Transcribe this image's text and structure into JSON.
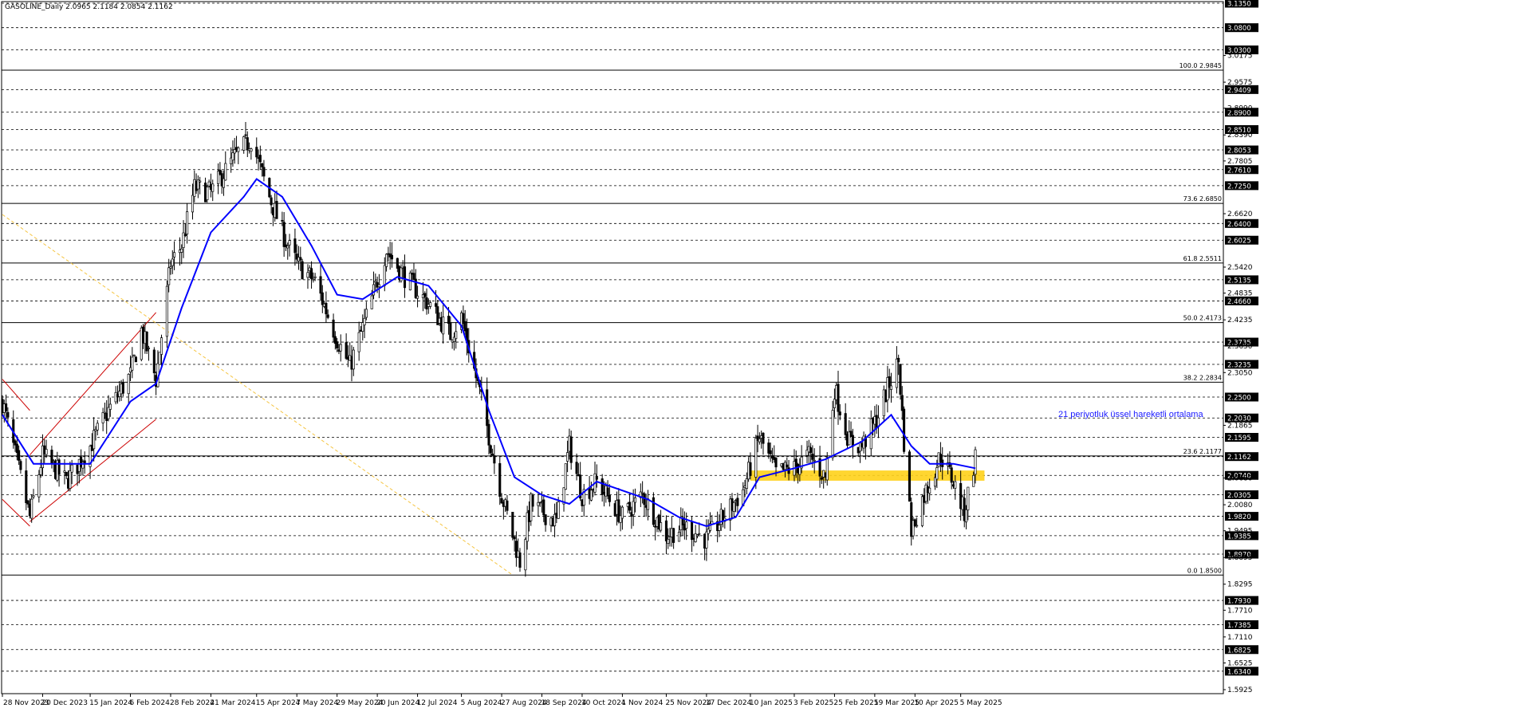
{
  "header": {
    "title": "GASOLINE_Daily  2.0965 2.1184 2.0854 2.1162"
  },
  "colors": {
    "background": "#ffffff",
    "candle": "#000000",
    "ema": "#0000ff",
    "channel": "#cc0000",
    "trendline": "#f5c542",
    "zone": "#ffd21a",
    "grid": "#000000"
  },
  "chart_data": {
    "type": "candlestick",
    "symbol": "GASOLINE",
    "timeframe": "Daily",
    "ohlc_last": {
      "open": 2.0965,
      "high": 2.1184,
      "low": 2.0854,
      "close": 2.1162
    },
    "ylim": [
      1.5925,
      3.135
    ],
    "x_range": [
      "2023-11-28",
      "2025-05-13"
    ],
    "price_levels": [
      {
        "value": 3.135,
        "label": "3.1350"
      },
      {
        "value": 3.08,
        "label": "3.0800"
      },
      {
        "value": 3.03,
        "label": "3.0300"
      },
      {
        "value": 2.9409,
        "label": "2.9409"
      },
      {
        "value": 2.89,
        "label": "2.8900"
      },
      {
        "value": 2.851,
        "label": "2.8510"
      },
      {
        "value": 2.8053,
        "label": "2.8053"
      },
      {
        "value": 2.761,
        "label": "2.7610"
      },
      {
        "value": 2.725,
        "label": "2.7250"
      },
      {
        "value": 2.64,
        "label": "2.6400"
      },
      {
        "value": 2.6025,
        "label": "2.6025"
      },
      {
        "value": 2.5135,
        "label": "2.5135"
      },
      {
        "value": 2.466,
        "label": "2.4660"
      },
      {
        "value": 2.3735,
        "label": "2.3735"
      },
      {
        "value": 2.3235,
        "label": "2.3235"
      },
      {
        "value": 2.25,
        "label": "2.2500"
      },
      {
        "value": 2.203,
        "label": "2.2030"
      },
      {
        "value": 2.1595,
        "label": "2.1595"
      },
      {
        "value": 2.1162,
        "label": "2.1162"
      },
      {
        "value": 2.074,
        "label": "2.0740"
      },
      {
        "value": 2.0305,
        "label": "2.0305"
      },
      {
        "value": 1.982,
        "label": "1.9820"
      },
      {
        "value": 1.9385,
        "label": "1.9385"
      },
      {
        "value": 1.897,
        "label": "1.8970"
      },
      {
        "value": 1.793,
        "label": "1.7930"
      },
      {
        "value": 1.7385,
        "label": "1.7385"
      },
      {
        "value": 1.6825,
        "label": "1.6825"
      },
      {
        "value": 1.634,
        "label": "1.6340"
      }
    ],
    "minor_ticks": [
      {
        "value": 3.0175,
        "label": "3.0175"
      },
      {
        "value": 2.9575,
        "label": "2.9575"
      },
      {
        "value": 2.899,
        "label": "2.8990"
      },
      {
        "value": 2.839,
        "label": "2.8390"
      },
      {
        "value": 2.7805,
        "label": "2.7805"
      },
      {
        "value": 2.662,
        "label": "2.6620"
      },
      {
        "value": 2.542,
        "label": "2.5420"
      },
      {
        "value": 2.4835,
        "label": "2.4835"
      },
      {
        "value": 2.4235,
        "label": "2.4235"
      },
      {
        "value": 2.365,
        "label": "2.3650"
      },
      {
        "value": 2.305,
        "label": "2.3050"
      },
      {
        "value": 2.1865,
        "label": "2.1865"
      },
      {
        "value": 2.068,
        "label": "2.0680"
      },
      {
        "value": 2.008,
        "label": "2.0080"
      },
      {
        "value": 1.9495,
        "label": "1.9495"
      },
      {
        "value": 1.8895,
        "label": "1.8895"
      },
      {
        "value": 1.8295,
        "label": "1.8295"
      },
      {
        "value": 1.771,
        "label": "1.7710"
      },
      {
        "value": 1.711,
        "label": "1.7110"
      },
      {
        "value": 1.6525,
        "label": "1.6525"
      },
      {
        "value": 1.5925,
        "label": "1.5925"
      }
    ],
    "fibonacci": [
      {
        "label": "100.0 2.9845",
        "value": 2.9845
      },
      {
        "label": "73.6 2.6850",
        "value": 2.685
      },
      {
        "label": "61.8 2.5511",
        "value": 2.5511
      },
      {
        "label": "50.0 2.4173",
        "value": 2.4173
      },
      {
        "label": "38.2 2.2834",
        "value": 2.2834
      },
      {
        "label": "23.6 2.1177",
        "value": 2.1177
      },
      {
        "label": "0.0 1.8500",
        "value": 1.85
      }
    ],
    "x_labels": [
      "28 Nov 2023",
      "20 Dec 2023",
      "15 Jan 2024",
      "6 Feb 2024",
      "28 Feb 2024",
      "21 Mar 2024",
      "15 Apr 2024",
      "7 May 2024",
      "29 May 2024",
      "20 Jun 2024",
      "12 Jul 2024",
      "5 Aug 2024",
      "27 Aug 2024",
      "18 Sep 2024",
      "10 Oct 2024",
      "1 Nov 2024",
      "25 Nov 2024",
      "17 Dec 2024",
      "10 Jan 2025",
      "3 Feb 2025",
      "25 Feb 2025",
      "19 Mar 2025",
      "10 Apr 2025",
      "5 May 2025"
    ],
    "price_path": [
      [
        "2023-11-28",
        2.24
      ],
      [
        "2023-12-08",
        2.07
      ],
      [
        "2023-12-13",
        1.98
      ],
      [
        "2023-12-20",
        2.12
      ],
      [
        "2024-01-02",
        2.06
      ],
      [
        "2024-01-15",
        2.14
      ],
      [
        "2024-01-25",
        2.22
      ],
      [
        "2024-02-06",
        2.3
      ],
      [
        "2024-02-12",
        2.4
      ],
      [
        "2024-02-20",
        2.29
      ],
      [
        "2024-02-28",
        2.55
      ],
      [
        "2024-03-05",
        2.59
      ],
      [
        "2024-03-12",
        2.72
      ],
      [
        "2024-03-21",
        2.71
      ],
      [
        "2024-04-03",
        2.79
      ],
      [
        "2024-04-12",
        2.83
      ],
      [
        "2024-04-22",
        2.7
      ],
      [
        "2024-05-01",
        2.6
      ],
      [
        "2024-05-07",
        2.55
      ],
      [
        "2024-05-17",
        2.51
      ],
      [
        "2024-05-29",
        2.38
      ],
      [
        "2024-06-05",
        2.32
      ],
      [
        "2024-06-14",
        2.43
      ],
      [
        "2024-06-25",
        2.58
      ],
      [
        "2024-07-05",
        2.52
      ],
      [
        "2024-07-18",
        2.46
      ],
      [
        "2024-07-30",
        2.39
      ],
      [
        "2024-08-05",
        2.43
      ],
      [
        "2024-08-15",
        2.26
      ],
      [
        "2024-08-27",
        2.03
      ],
      [
        "2024-09-06",
        1.88
      ],
      [
        "2024-09-12",
        2.01
      ],
      [
        "2024-09-26",
        1.97
      ],
      [
        "2024-10-03",
        2.14
      ],
      [
        "2024-10-10",
        2.03
      ],
      [
        "2024-10-18",
        2.06
      ],
      [
        "2024-11-01",
        1.98
      ],
      [
        "2024-11-12",
        2.03
      ],
      [
        "2024-11-25",
        1.94
      ],
      [
        "2024-12-05",
        1.96
      ],
      [
        "2024-12-17",
        1.93
      ],
      [
        "2025-01-06",
        2.04
      ],
      [
        "2025-01-15",
        2.16
      ],
      [
        "2025-01-24",
        2.08
      ],
      [
        "2025-02-03",
        2.09
      ],
      [
        "2025-02-11",
        2.12
      ],
      [
        "2025-02-20",
        2.07
      ],
      [
        "2025-02-25",
        2.27
      ],
      [
        "2025-03-05",
        2.15
      ],
      [
        "2025-03-12",
        2.14
      ],
      [
        "2025-03-20",
        2.2
      ],
      [
        "2025-03-26",
        2.27
      ],
      [
        "2025-04-01",
        2.33
      ],
      [
        "2025-04-04",
        2.15
      ],
      [
        "2025-04-08",
        1.95
      ],
      [
        "2025-04-14",
        2.02
      ],
      [
        "2025-04-24",
        2.12
      ],
      [
        "2025-05-01",
        2.06
      ],
      [
        "2025-05-07",
        1.99
      ],
      [
        "2025-05-13",
        2.1162
      ]
    ],
    "ema_path": [
      [
        "2023-11-28",
        2.21
      ],
      [
        "2023-12-15",
        2.1
      ],
      [
        "2024-01-02",
        2.1
      ],
      [
        "2024-01-15",
        2.1
      ],
      [
        "2024-02-06",
        2.24
      ],
      [
        "2024-02-20",
        2.28
      ],
      [
        "2024-03-05",
        2.45
      ],
      [
        "2024-03-21",
        2.62
      ],
      [
        "2024-04-08",
        2.7
      ],
      [
        "2024-04-15",
        2.74
      ],
      [
        "2024-04-29",
        2.7
      ],
      [
        "2024-05-15",
        2.59
      ],
      [
        "2024-05-29",
        2.48
      ],
      [
        "2024-06-12",
        2.47
      ],
      [
        "2024-07-01",
        2.52
      ],
      [
        "2024-07-18",
        2.5
      ],
      [
        "2024-08-05",
        2.41
      ],
      [
        "2024-08-20",
        2.22
      ],
      [
        "2024-09-03",
        2.07
      ],
      [
        "2024-09-18",
        2.03
      ],
      [
        "2024-10-03",
        2.01
      ],
      [
        "2024-10-18",
        2.06
      ],
      [
        "2024-11-01",
        2.04
      ],
      [
        "2024-11-15",
        2.02
      ],
      [
        "2024-12-02",
        1.98
      ],
      [
        "2024-12-17",
        1.96
      ],
      [
        "2025-01-02",
        1.98
      ],
      [
        "2025-01-15",
        2.07
      ],
      [
        "2025-02-03",
        2.09
      ],
      [
        "2025-02-20",
        2.11
      ],
      [
        "2025-03-12",
        2.15
      ],
      [
        "2025-03-28",
        2.21
      ],
      [
        "2025-04-08",
        2.14
      ],
      [
        "2025-04-18",
        2.1
      ],
      [
        "2025-05-01",
        2.1
      ],
      [
        "2025-05-13",
        2.09
      ]
    ],
    "annotations": [
      {
        "type": "zone",
        "x_start": "2025-01-10",
        "x_end": "2025-05-18",
        "y_low": 2.062,
        "y_high": 2.085
      },
      {
        "type": "channel",
        "upper": [
          [
            "2023-12-13",
            2.12
          ],
          [
            "2024-02-20",
            2.44
          ]
        ],
        "lower": [
          [
            "2023-12-13",
            1.97
          ],
          [
            "2024-02-20",
            2.2
          ]
        ]
      },
      {
        "type": "channel_start",
        "upper": [
          [
            "2023-11-28",
            2.29
          ],
          [
            "2023-12-13",
            2.22
          ]
        ],
        "lower": [
          [
            "2023-11-28",
            2.02
          ],
          [
            "2023-12-13",
            1.96
          ]
        ]
      },
      {
        "type": "trendline",
        "from": [
          "2023-11-28",
          2.66
        ],
        "to": [
          "2024-09-02",
          1.85
        ]
      }
    ],
    "ema_label": "21 periyotluk üssel hareketli ortalama",
    "grid": "dashed horizontal"
  }
}
